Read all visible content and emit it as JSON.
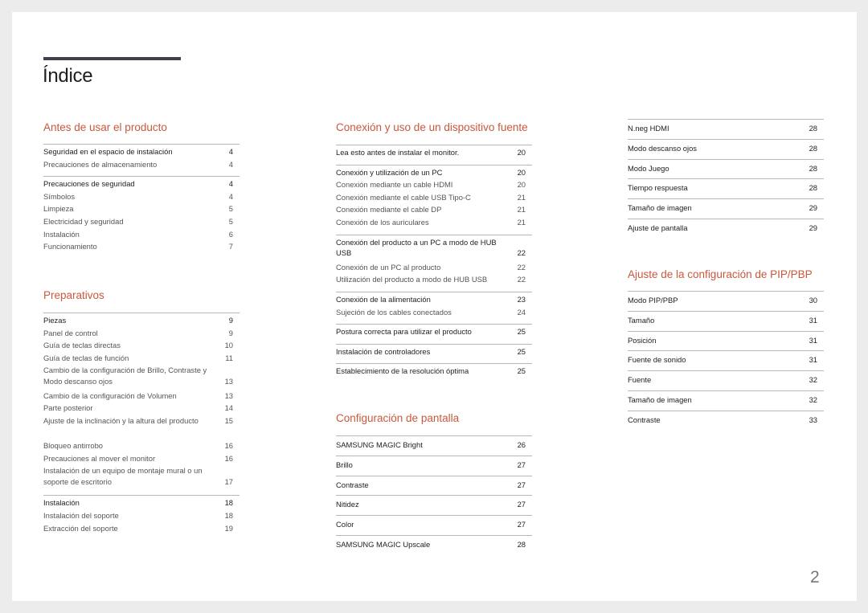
{
  "title": "Índice",
  "page_number": "2",
  "accent_color": "#c8593d",
  "columns": [
    {
      "sections": [
        {
          "title": "Antes de usar el producto",
          "groups": [
            {
              "items": [
                {
                  "label": "Seguridad en el espacio de instalación",
                  "page": "4",
                  "main": true
                },
                {
                  "label": "Precauciones de almacenamiento",
                  "page": "4",
                  "main": false
                }
              ]
            },
            {
              "items": [
                {
                  "label": "Precauciones de seguridad",
                  "page": "4",
                  "main": true
                },
                {
                  "label": "Símbolos",
                  "page": "4",
                  "main": false
                },
                {
                  "label": "Limpieza",
                  "page": "5",
                  "main": false
                },
                {
                  "label": "Electricidad y seguridad",
                  "page": "5",
                  "main": false
                },
                {
                  "label": "Instalación",
                  "page": "6",
                  "main": false
                },
                {
                  "label": "Funcionamiento",
                  "page": "7",
                  "main": false
                }
              ]
            }
          ]
        },
        {
          "title": "Preparativos",
          "groups": [
            {
              "items": [
                {
                  "label": "Piezas",
                  "page": "9",
                  "main": true
                },
                {
                  "label": "Panel de control",
                  "page": "9",
                  "main": false
                },
                {
                  "label": "Guía de teclas directas",
                  "page": "10",
                  "main": false
                },
                {
                  "label": "Guía de teclas de función",
                  "page": "11",
                  "main": false
                },
                {
                  "label": "Cambio de la configuración de Brillo, Contraste y Modo descanso ojos",
                  "page": "13",
                  "main": false
                },
                {
                  "label": "Cambio de la configuración de Volumen",
                  "page": "13",
                  "main": false
                },
                {
                  "label": "Parte posterior",
                  "page": "14",
                  "main": false
                },
                {
                  "label": "Ajuste de la inclinación y la altura del producto",
                  "page": "15",
                  "main": false
                },
                {
                  "label": "Bloqueo antirrobo",
                  "page": "16",
                  "main": false
                },
                {
                  "label": "Precauciones al mover el monitor",
                  "page": "16",
                  "main": false
                },
                {
                  "label": "Instalación de un equipo de montaje mural o un soporte de escritorio",
                  "page": "17",
                  "main": false
                }
              ]
            },
            {
              "items": [
                {
                  "label": "Instalación",
                  "page": "18",
                  "main": true
                },
                {
                  "label": "Instalación del soporte",
                  "page": "18",
                  "main": false
                },
                {
                  "label": "Extracción del soporte",
                  "page": "19",
                  "main": false
                }
              ]
            }
          ]
        }
      ]
    },
    {
      "sections": [
        {
          "title": "Conexión y uso de un dispositivo fuente",
          "groups": [
            {
              "items": [
                {
                  "label": "Lea esto antes de instalar el monitor.",
                  "page": "20",
                  "main": true
                }
              ]
            },
            {
              "items": [
                {
                  "label": "Conexión y utilización de un PC",
                  "page": "20",
                  "main": true
                },
                {
                  "label": "Conexión mediante un cable HDMI",
                  "page": "20",
                  "main": false
                },
                {
                  "label": "Conexión mediante el cable USB Tipo-C",
                  "page": "21",
                  "main": false
                },
                {
                  "label": "Conexión mediante el cable DP",
                  "page": "21",
                  "main": false
                },
                {
                  "label": "Conexión de los auriculares",
                  "page": "21",
                  "main": false
                }
              ]
            },
            {
              "items": [
                {
                  "label": "Conexión del producto a un PC a modo de HUB USB",
                  "page": "22",
                  "main": true
                },
                {
                  "label": "Conexión de un PC al producto",
                  "page": "22",
                  "main": false
                },
                {
                  "label": "Utilización del producto a modo de HUB USB",
                  "page": "22",
                  "main": false
                }
              ]
            },
            {
              "items": [
                {
                  "label": "Conexión de la alimentación",
                  "page": "23",
                  "main": true
                },
                {
                  "label": "Sujeción de los cables conectados",
                  "page": "24",
                  "main": false
                }
              ]
            },
            {
              "items": [
                {
                  "label": "Postura correcta para utilizar el producto",
                  "page": "25",
                  "main": true
                }
              ]
            },
            {
              "items": [
                {
                  "label": "Instalación de controladores",
                  "page": "25",
                  "main": true
                }
              ]
            },
            {
              "items": [
                {
                  "label": "Establecimiento de la resolución óptima",
                  "page": "25",
                  "main": true
                }
              ]
            }
          ]
        },
        {
          "title": "Configuración de pantalla",
          "groups": [
            {
              "items": [
                {
                  "label": "SAMSUNG MAGIC Bright",
                  "page": "26",
                  "main": true
                }
              ]
            },
            {
              "items": [
                {
                  "label": "Brillo",
                  "page": "27",
                  "main": true
                }
              ]
            },
            {
              "items": [
                {
                  "label": "Contraste",
                  "page": "27",
                  "main": true
                }
              ]
            },
            {
              "items": [
                {
                  "label": "Nitidez",
                  "page": "27",
                  "main": true
                }
              ]
            },
            {
              "items": [
                {
                  "label": "Color",
                  "page": "27",
                  "main": true
                }
              ]
            },
            {
              "items": [
                {
                  "label": "SAMSUNG MAGIC Upscale",
                  "page": "28",
                  "main": true
                }
              ]
            }
          ]
        }
      ]
    },
    {
      "sections": [
        {
          "title": "",
          "groups": [
            {
              "items": [
                {
                  "label": "N.neg HDMI",
                  "page": "28",
                  "main": true
                }
              ]
            },
            {
              "items": [
                {
                  "label": "Modo descanso ojos",
                  "page": "28",
                  "main": true
                }
              ]
            },
            {
              "items": [
                {
                  "label": "Modo Juego",
                  "page": "28",
                  "main": true
                }
              ]
            },
            {
              "items": [
                {
                  "label": "Tiempo respuesta",
                  "page": "28",
                  "main": true
                }
              ]
            },
            {
              "items": [
                {
                  "label": "Tamaño de imagen",
                  "page": "29",
                  "main": true
                }
              ]
            },
            {
              "items": [
                {
                  "label": "Ajuste de pantalla",
                  "page": "29",
                  "main": true
                }
              ]
            }
          ]
        },
        {
          "title": "Ajuste de la configuración de PIP/PBP",
          "groups": [
            {
              "items": [
                {
                  "label": "Modo PIP/PBP",
                  "page": "30",
                  "main": true
                }
              ]
            },
            {
              "items": [
                {
                  "label": "Tamaño",
                  "page": "31",
                  "main": true
                }
              ]
            },
            {
              "items": [
                {
                  "label": "Posición",
                  "page": "31",
                  "main": true
                }
              ]
            },
            {
              "items": [
                {
                  "label": "Fuente de sonido",
                  "page": "31",
                  "main": true
                }
              ]
            },
            {
              "items": [
                {
                  "label": "Fuente",
                  "page": "32",
                  "main": true
                }
              ]
            },
            {
              "items": [
                {
                  "label": "Tamaño de imagen",
                  "page": "32",
                  "main": true
                }
              ]
            },
            {
              "items": [
                {
                  "label": "Contraste",
                  "page": "33",
                  "main": true
                }
              ]
            }
          ]
        }
      ]
    }
  ]
}
